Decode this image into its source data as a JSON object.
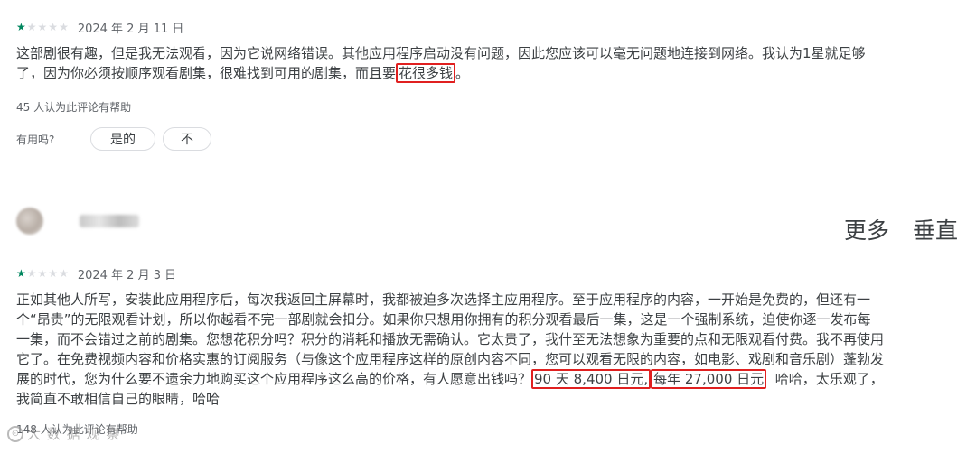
{
  "review1": {
    "rating": 1,
    "date": "2024 年 2 月 11 日",
    "text_part1": "这部剧很有趣，但是我无法观看，因为它说网络错误。其他应用程序启动没有问题，因此您应该可以毫无问题地连接到网络。我认为1星就足够了，因为你必须按顺序观看剧集，很难找到可用的剧集，而且要",
    "text_highlight": "花很多钱",
    "text_part2": "。",
    "helpful_count": "45 人认为此评论有帮助",
    "helpful_question": "有用吗?",
    "yes_label": "是的",
    "no_label": "不"
  },
  "header_actions": {
    "more": "更多",
    "vertical": "垂直"
  },
  "review2": {
    "rating": 1,
    "date": "2024 年 2 月 3 日",
    "text_part1": "正如其他人所写，安装此应用程序后，每次我返回主屏幕时，我都被迫多次选择主应用程序。至于应用程序的内容，一开始是免费的，但还有一个“昂贵”的无限观看计划，所以你越看不完一部剧就会扣分。如果你只想用你拥有的积分观看最后一集，这是一个强制系统，迫使你逐一发布每一集，而不会错过之前的剧集。您想花积分吗？积分的消耗和播放无需确认。它太贵了，我什至无法想象为重要的点和无限观看付费。我不再使用它了。在免费视频内容和价格实惠的订阅服务（与像这个应用程序这样的原创内容不同，您可以观看无限的内容，如电影、戏剧和音乐剧）蓬勃发展的时代，您为什么要不遗余力地购买这个应用程序这么高的价格，有人愿意出钱吗？",
    "text_highlight1": "90 天 8,400 日元,",
    "text_highlight2": "每年 27,000 日元",
    "text_part2": "哈哈，太乐观了，我简直不敢相信自己的眼睛，哈哈",
    "helpful_count": "148 人认为此评论有帮助"
  },
  "watermark": {
    "text": "大 数 据 观 察"
  },
  "colors": {
    "star_on": "#01875f",
    "star_off": "#dadce0",
    "highlight_border": "#e02020"
  }
}
